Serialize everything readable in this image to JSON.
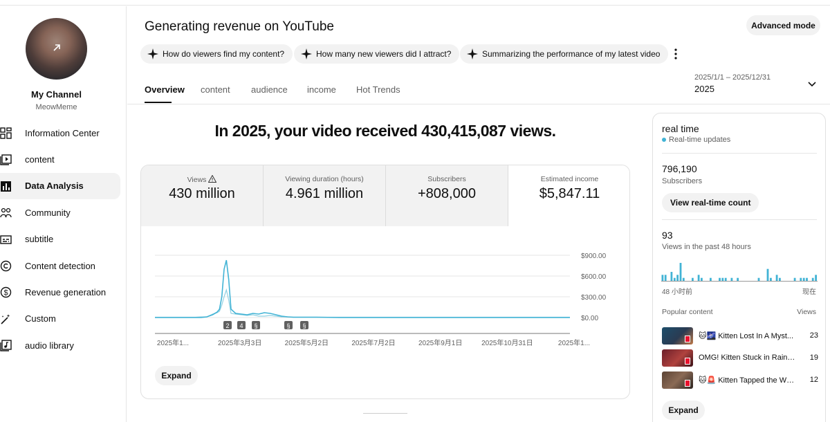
{
  "colors": {
    "accent_line": "#41b3d5",
    "chip_bg": "#f2f2f2",
    "text": "#0f0f0f",
    "muted": "#606060"
  },
  "sidebar": {
    "channel_name": "My Channel",
    "channel_handle": "MeowMeme",
    "items": [
      {
        "label": "Information Center",
        "icon": "dashboard-icon",
        "active": false
      },
      {
        "label": "content",
        "icon": "video-library-icon",
        "active": false
      },
      {
        "label": "Data Analysis",
        "icon": "bar-chart-icon",
        "active": true
      },
      {
        "label": "Community",
        "icon": "people-icon",
        "active": false
      },
      {
        "label": "subtitle",
        "icon": "subtitles-icon",
        "active": false
      },
      {
        "label": "Content detection",
        "icon": "copyright-icon",
        "active": false
      },
      {
        "label": "Revenue generation",
        "icon": "dollar-icon",
        "active": false
      },
      {
        "label": "Custom",
        "icon": "magic-wand-icon",
        "active": false
      },
      {
        "label": "audio library",
        "icon": "audio-library-icon",
        "active": false
      }
    ]
  },
  "header": {
    "title": "Generating revenue on YouTube",
    "advanced_mode": "Advanced mode",
    "chips": [
      "How do viewers find my content?",
      "How many new viewers did I attract?",
      "Summarizing the performance of my latest video"
    ],
    "tabs": [
      "Overview",
      "content",
      "audience",
      "income",
      "Hot Trends"
    ],
    "active_tab": "Overview",
    "date_range": "2025/1/1 – 2025/12/31",
    "date_label": "2025"
  },
  "main": {
    "headline": "In 2025, your video received 430,415,087 views.",
    "metrics": [
      {
        "label": "Views",
        "value": "430 million"
      },
      {
        "label": "Viewing duration (hours)",
        "value": "4.961 million"
      },
      {
        "label": "Subscribers",
        "value": "+808,000"
      },
      {
        "label": "Estimated income",
        "value": "$5,847.11"
      }
    ],
    "expand": "Expand"
  },
  "chart_data": {
    "type": "line",
    "x_ticks": [
      "2025年1...",
      "2025年3月3日",
      "2025年5月2日",
      "2025年7月2日",
      "2025年9月1日",
      "2025年10月31日",
      "2025年1..."
    ],
    "y_ticks": [
      "$900.00",
      "$600.00",
      "$300.00",
      "$0.00"
    ],
    "ylim": [
      0,
      1000
    ],
    "x": [
      0,
      5,
      10,
      15,
      20,
      25,
      30,
      35,
      40,
      45,
      50,
      52,
      54,
      56,
      58,
      60,
      62,
      64,
      66,
      70,
      75,
      80,
      85,
      90,
      95,
      100,
      105,
      110,
      115,
      120,
      130,
      140,
      160,
      180,
      200,
      220,
      240,
      260,
      280,
      300,
      320,
      340,
      360
    ],
    "series": [
      {
        "values": [
          5,
          5,
          5,
          5,
          5,
          5,
          5,
          5,
          10,
          10,
          50,
          60,
          70,
          90,
          180,
          300,
          400,
          250,
          60,
          50,
          40,
          30,
          40,
          20,
          20,
          30,
          20,
          10,
          10,
          5,
          5,
          5,
          5,
          5,
          5,
          5,
          5,
          5,
          5,
          5,
          5,
          5,
          5
        ]
      },
      {
        "values": [
          0,
          0,
          0,
          0,
          0,
          0,
          0,
          0,
          0,
          10,
          40,
          60,
          80,
          120,
          300,
          700,
          830,
          550,
          120,
          60,
          50,
          40,
          60,
          50,
          70,
          60,
          40,
          20,
          10,
          5,
          5,
          5,
          0,
          0,
          0,
          0,
          0,
          0,
          0,
          0,
          0,
          0,
          0
        ]
      }
    ],
    "markers": [
      "2",
      "4",
      "shorts",
      "shorts",
      "shorts"
    ]
  },
  "realtime": {
    "title": "real time",
    "subtitle": "Real-time updates",
    "subscribers_value": "796,190",
    "subscribers_label": "Subscribers",
    "view_count_button": "View real-time count",
    "views48_value": "93",
    "views48_label": "Views in the past 48 hours",
    "axis_left": "48 小时前",
    "axis_right": "现在",
    "bars": [
      2,
      2,
      0,
      3,
      1,
      2,
      6,
      1,
      0,
      0,
      1,
      0,
      2,
      1,
      0,
      0,
      1,
      0,
      0,
      1,
      1,
      1,
      0,
      1,
      0,
      1,
      0,
      0,
      0,
      0,
      0,
      0,
      1,
      0,
      0,
      4,
      1,
      0,
      2,
      1,
      0,
      0,
      0,
      0,
      1,
      0,
      1,
      1,
      1,
      0,
      1,
      2
    ],
    "popular_label": "Popular content",
    "views_label": "Views",
    "videos": [
      {
        "title": "🐱🌌 Kitten Lost In A Myst...",
        "views": "23"
      },
      {
        "title": "OMG! Kitten Stuck in Rainbo...",
        "views": "19"
      },
      {
        "title": "🐱🚨 Kitten Tapped the WR...",
        "views": "12"
      }
    ],
    "expand": "Expand"
  }
}
